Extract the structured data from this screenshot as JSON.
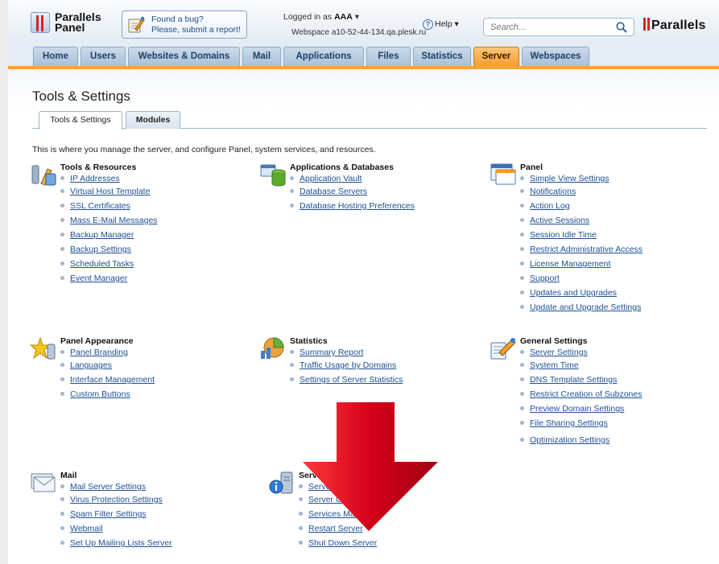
{
  "header": {
    "product_line1": "Parallels",
    "product_line2": "Panel",
    "bug_line1": "Found a bug?",
    "bug_line2": "Please, submit a report!",
    "logged_in_label": "Logged in as",
    "user": "AAA",
    "webspace": "Webspace a10-52-44-134.qa.plesk.ru",
    "help_label": "Help",
    "search_placeholder": "Search...",
    "brand": "Parallels"
  },
  "nav": {
    "tabs": [
      {
        "label": "Home"
      },
      {
        "label": "Users"
      },
      {
        "label": "Websites & Domains"
      },
      {
        "label": "Mail"
      },
      {
        "label": "Applications"
      },
      {
        "label": "Files"
      },
      {
        "label": "Statistics"
      },
      {
        "label": "Server"
      },
      {
        "label": "Webspaces"
      }
    ],
    "active": "Server"
  },
  "page": {
    "title": "Tools & Settings",
    "subtabs": [
      "Tools & Settings",
      "Modules"
    ],
    "intro": "This is where you manage the server, and configure Panel, system services, and resources."
  },
  "groups": [
    {
      "title": "Tools & Resources",
      "icon": "tools-icon",
      "items": [
        "IP Addresses",
        "Virtual Host Template",
        "SSL Certificates",
        "Mass E-Mail Messages",
        "Backup Manager",
        "Backup Settings",
        "Scheduled Tasks",
        "Event Manager"
      ]
    },
    {
      "title": "Applications & Databases",
      "icon": "database-icon",
      "items": [
        "Application Vault",
        "Database Servers",
        "Database Hosting Preferences"
      ]
    },
    {
      "title": "Panel",
      "icon": "window-icon",
      "items": [
        "Simple View Settings",
        "Notifications",
        "Action Log",
        "Active Sessions",
        "Session Idle Time",
        "Restrict Administrative Access",
        "License Management",
        "Support",
        "Updates and Upgrades",
        "Update and Upgrade Settings"
      ]
    },
    {
      "title": "Panel Appearance",
      "icon": "star-icon",
      "items": [
        "Panel Branding",
        "Languages",
        "Interface Management",
        "Custom Buttons"
      ]
    },
    {
      "title": "Statistics",
      "icon": "chart-icon",
      "items": [
        "Summary Report",
        "Traffic Usage by Domains",
        "Settings of Server Statistics"
      ]
    },
    {
      "title": "General Settings",
      "icon": "settings-icon",
      "items": [
        "Server Settings",
        "System Time",
        "DNS Template Settings",
        "Restrict Creation of Subzones",
        "Preview Domain Settings",
        "File Sharing Settings",
        "Optimization Settings"
      ]
    },
    {
      "title": "Mail",
      "icon": "mail-icon",
      "items": [
        "Mail Server Settings",
        "Virus Protection Settings",
        "Spam Filter Settings",
        "Webmail",
        "Set Up Mailing Lists Server"
      ]
    },
    {
      "title": "Server",
      "icon": "server-icon",
      "items": [
        "Server",
        "Server Com",
        "Services Manag",
        "Restart Server",
        "Shut Down Server"
      ]
    }
  ],
  "colors": {
    "link": "#1e4f94",
    "nav_tab": "#a9c0d9",
    "nav_active": "#f39d2e",
    "arrow": "#d0021b"
  }
}
